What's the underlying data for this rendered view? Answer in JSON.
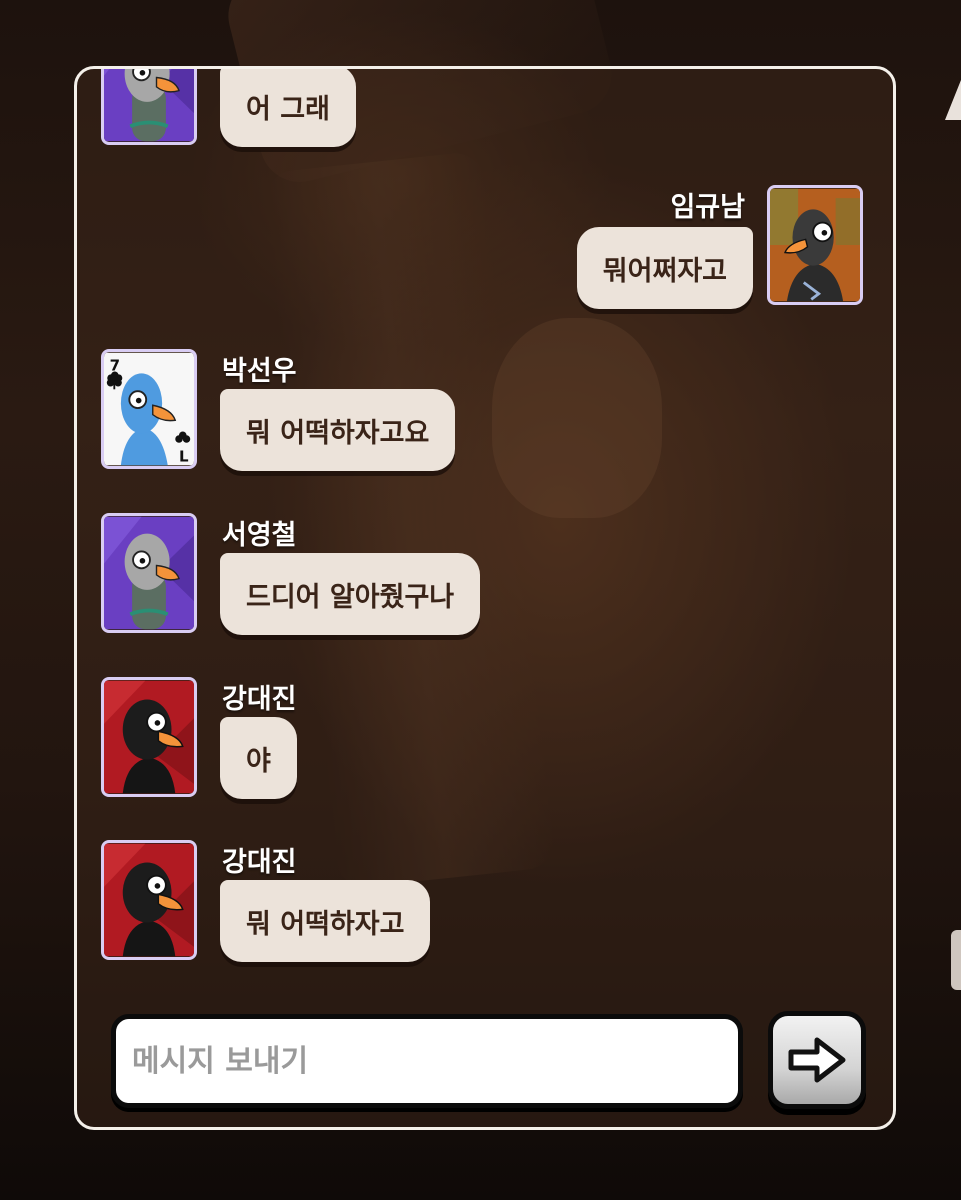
{
  "chat": {
    "messages": [
      {
        "sender": "",
        "text": "어 그래",
        "avatar": "purple-goose-avatar",
        "own": false
      },
      {
        "sender": "임규남",
        "text": "뭐어쩌자고",
        "avatar": "orange-goose-avatar",
        "own": true
      },
      {
        "sender": "박선우",
        "text": "뭐 어떡하자고요",
        "avatar": "seven-of-clubs-goose-card",
        "own": false
      },
      {
        "sender": "서영철",
        "text": "드디어 알아줬구나",
        "avatar": "purple-goose-avatar",
        "own": false
      },
      {
        "sender": "강대진",
        "text": "야",
        "avatar": "red-black-duck-avatar",
        "own": false
      },
      {
        "sender": "강대진",
        "text": "뭐 어떡하자고",
        "avatar": "red-black-duck-avatar",
        "own": false
      }
    ],
    "card_rank": "7",
    "card_rank_flipped": "L"
  },
  "composer": {
    "placeholder": "메시지 보내기",
    "value": "",
    "send_icon": "right-arrow-icon"
  },
  "colors": {
    "panel_border": "#f4f0ea",
    "bubble_bg": "#ece3da",
    "bubble_text": "#3a2418",
    "sender_text": "#ffffff",
    "avatar_border": "#d9cdf3"
  }
}
